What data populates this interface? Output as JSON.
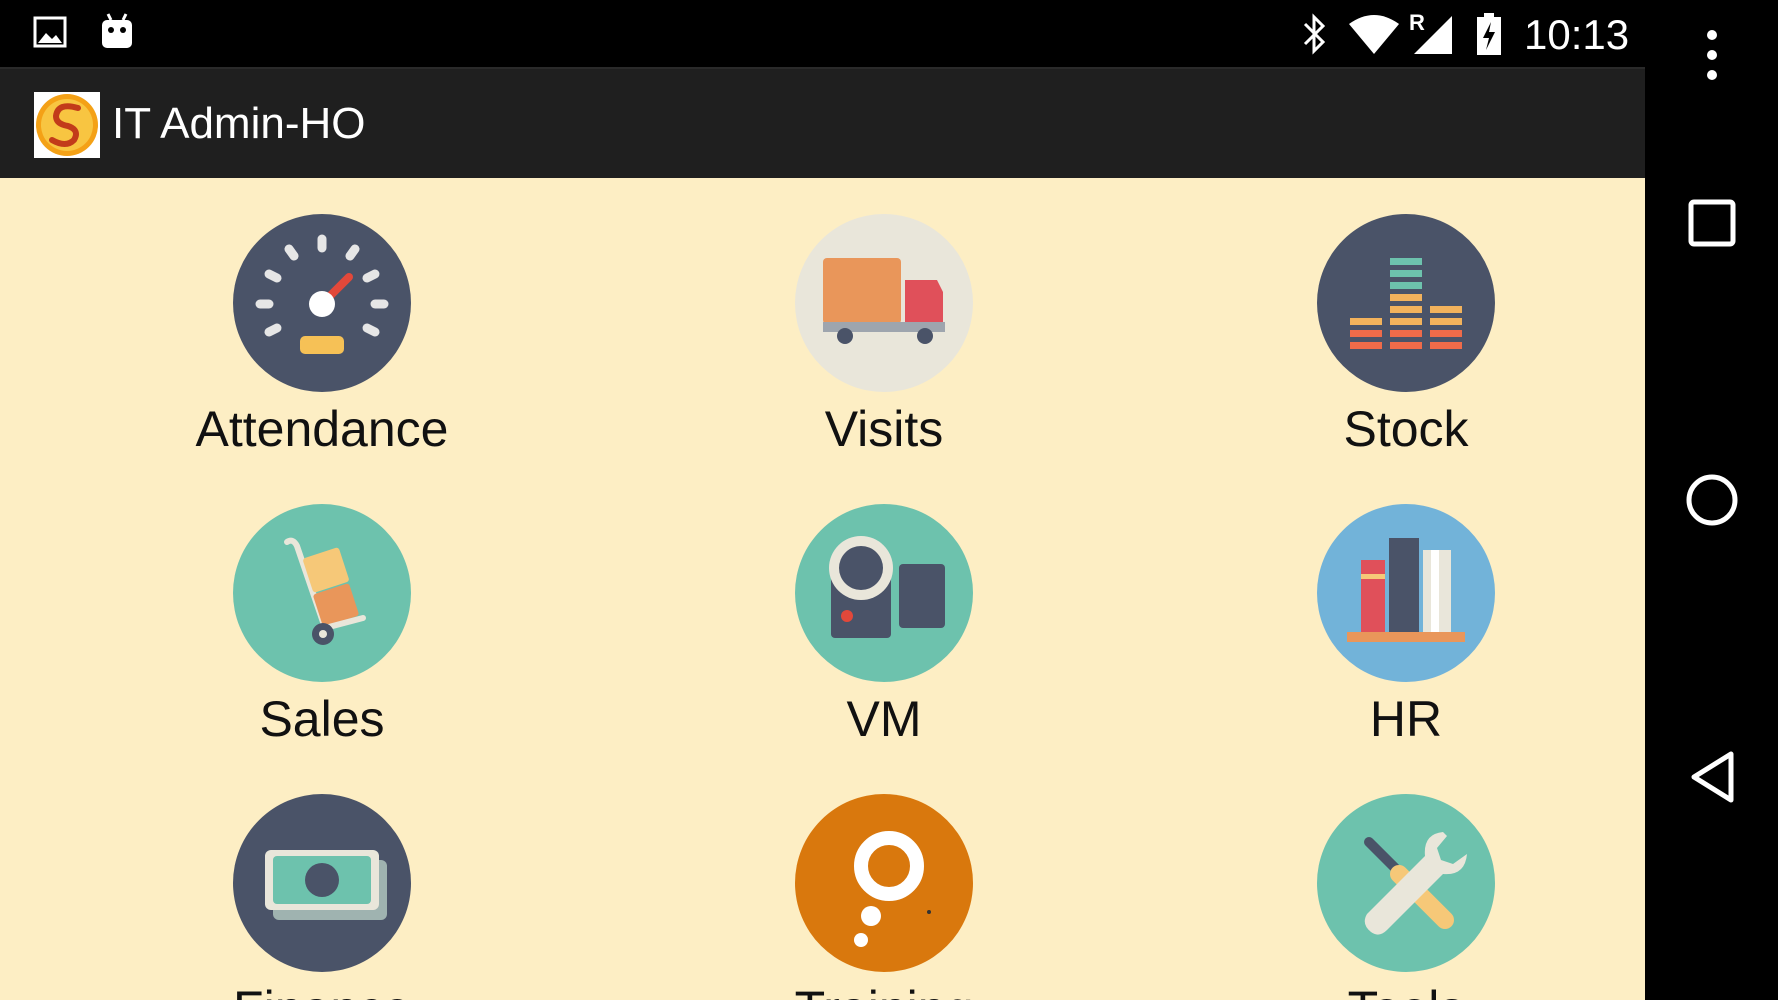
{
  "status_bar": {
    "time": "10:13",
    "roaming_indicator": "R",
    "icons": [
      "image-notification-icon",
      "android-notification-icon",
      "bluetooth-icon",
      "wifi-icon",
      "signal-icon",
      "battery-charging-icon"
    ]
  },
  "action_bar": {
    "title": "IT Admin-HO",
    "logo_icon": "app-logo-icon"
  },
  "tiles": [
    {
      "label": "Attendance",
      "icon": "speedometer-icon",
      "bg": "#4a5368"
    },
    {
      "label": "Visits",
      "icon": "truck-icon",
      "bg": "#e9e6da"
    },
    {
      "label": "Stock",
      "icon": "stacked-bars-icon",
      "bg": "#4a5368"
    },
    {
      "label": "Sales",
      "icon": "hand-truck-icon",
      "bg": "#6dc2ad"
    },
    {
      "label": "VM",
      "icon": "video-camera-icon",
      "bg": "#6dc2ad"
    },
    {
      "label": "HR",
      "icon": "books-icon",
      "bg": "#72b3d9"
    },
    {
      "label": "Finance",
      "icon": "cash-icon",
      "bg": "#4a5368"
    },
    {
      "label": "Training",
      "icon": "thought-bubble-icon",
      "bg": "#d9780d"
    },
    {
      "label": "Tools",
      "icon": "screwdriver-wrench-icon",
      "bg": "#6dc2ad"
    }
  ],
  "nav_bar": {
    "buttons": [
      "overflow-menu-icon",
      "recents-icon",
      "home-icon",
      "back-icon"
    ]
  },
  "colors": {
    "content_background": "#fdeec4",
    "action_bar": "#1f1f1f",
    "status_bar": "#000000"
  }
}
